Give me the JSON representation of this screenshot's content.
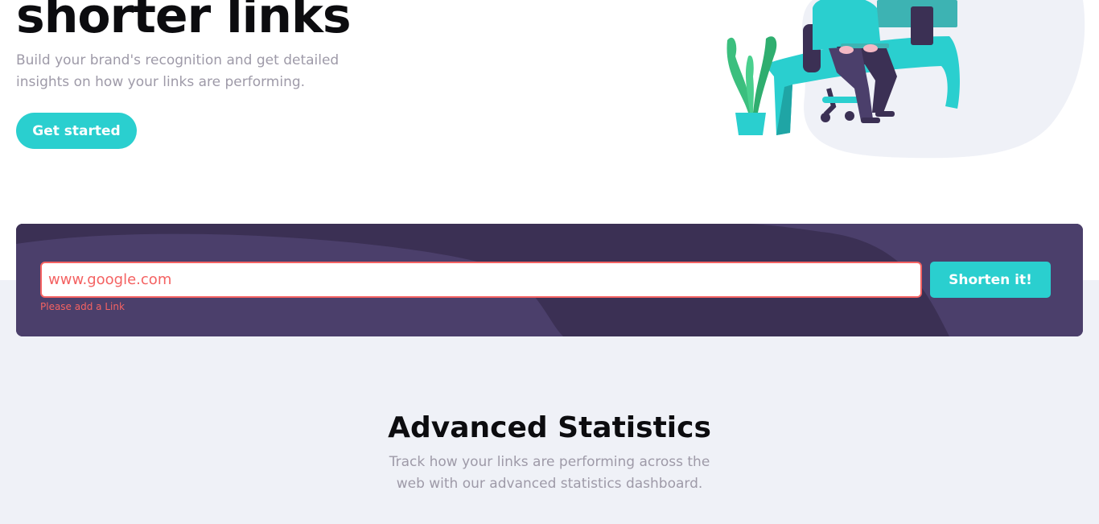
{
  "hero": {
    "title": "shorter links",
    "subtitle": "Build your brand's recognition and get detailed insights on how your links are performing.",
    "cta_label": "Get started"
  },
  "shorten": {
    "input_value": "www.google.com",
    "error_text": "Please add a Link",
    "button_label": "Shorten it!"
  },
  "statistics": {
    "title": "Advanced Statistics",
    "subtitle": "Track how your links are performing across the web with our advanced statistics dashboard."
  },
  "colors": {
    "accent": "#2acfcf",
    "dark_violet": "#4b3f6b",
    "error": "#f46262",
    "gray_text": "#9e9aa8",
    "light_gray_bg": "#eff1f7"
  },
  "icons": {
    "illustration": "person-working-at-desk-illustration"
  }
}
